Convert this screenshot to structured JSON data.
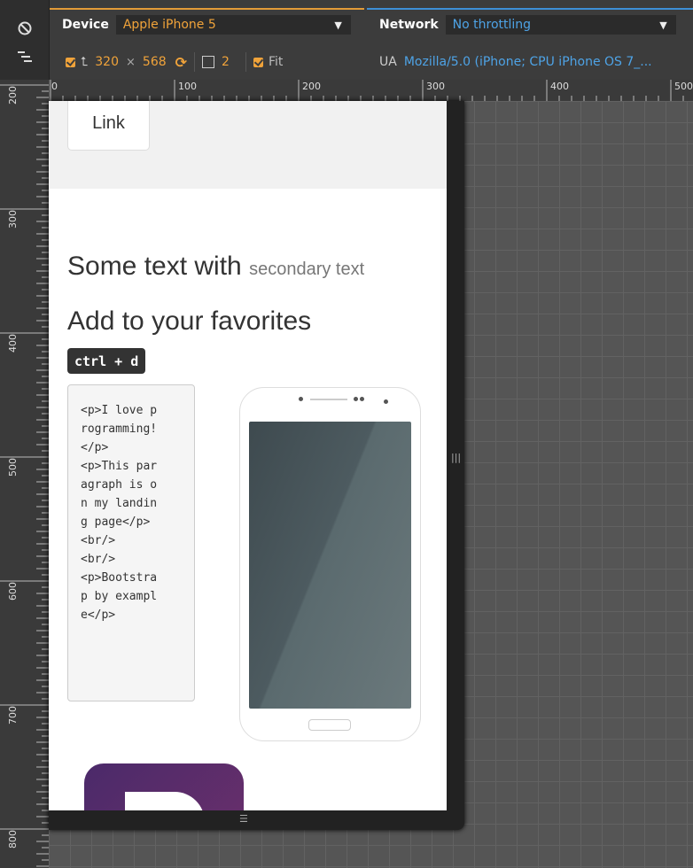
{
  "toolbar": {
    "device_label": "Device",
    "device_value": "Apple iPhone 5",
    "width": "320",
    "times": "×",
    "height": "568",
    "dpr": "2",
    "fit_label": "Fit",
    "network_label": "Network",
    "network_value": "No throttling",
    "ua_label": "UA",
    "ua_value": "Mozilla/5.0 (iPhone; CPU iPhone OS 7_..."
  },
  "ruler": {
    "horizontal": [
      "0",
      "100",
      "200",
      "300",
      "400",
      "500"
    ],
    "vertical": [
      "200",
      "300",
      "400",
      "500",
      "600",
      "700",
      "800"
    ]
  },
  "page": {
    "link_label": "Link",
    "text_main": "Some text with",
    "text_secondary": "secondary text",
    "favorites_heading": "Add to your favorites",
    "kbd": "ctrl + d",
    "code": "<p>I love p\nrogramming!\n</p>\n<p>This par\nagraph is o\nn my landin\ng page</p>\n<br/>\n<br/>\n<p>Bootstra\np by exampl\ne</p>"
  },
  "colors": {
    "device_accent": "#e29b38",
    "network_accent": "#3d8fd6",
    "logo_purple": "#563d7c"
  }
}
